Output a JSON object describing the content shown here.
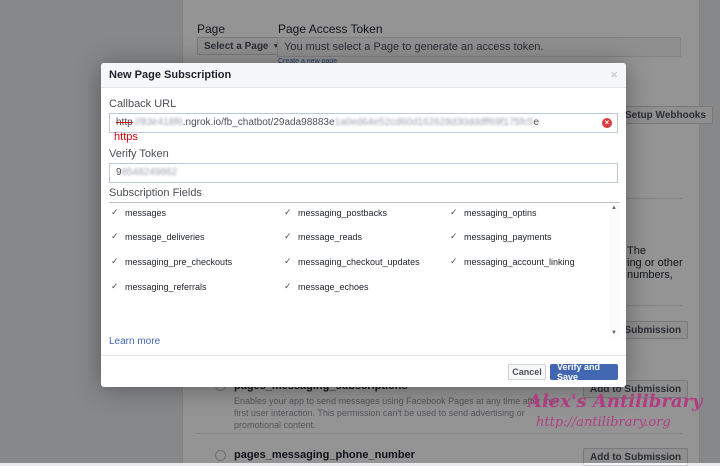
{
  "background": {
    "page_label": "Page",
    "select_page_button": "Select a Page",
    "access_token_label": "Page Access Token",
    "access_token_placeholder": "You must select a Page to generate an access token.",
    "create_page_link": "Create a new page",
    "setup_webhooks_button": "Setup Webhooks",
    "frag_the": "The",
    "frag_ing_or_other": "ing or other",
    "frag_numbers": "numbers,",
    "add_to_submission": "Add to Submission",
    "perm_subscription_title": "pages_messaging_subscriptions",
    "perm_subscription_desc": "Enables your app to send messages using Facebook Pages at any time after the first user interaction. This permission can't be used to send advertising or promotional content.",
    "perm_phone_title": "pages_messaging_phone_number"
  },
  "dialog": {
    "title": "New Page Subscription",
    "close_glyph": "×",
    "callback_label": "Callback URL",
    "callback_scheme": "http",
    "callback_blur1": "://83e418f6",
    "callback_visible": ".ngrok.io/fb_chatbot/29ada98883e",
    "callback_blur2": "1a0ed64e52cd60d162628d30dddff69f175fc5",
    "callback_end": "e",
    "https_note": "https",
    "verify_label": "Verify Token",
    "verify_prefix": "9",
    "verify_blur": "8548249862",
    "subscription_label": "Subscription Fields",
    "fields": [
      {
        "label": "messages",
        "checked": true
      },
      {
        "label": "messaging_postbacks",
        "checked": true
      },
      {
        "label": "messaging_optins",
        "checked": true
      },
      {
        "label": "message_deliveries",
        "checked": true
      },
      {
        "label": "message_reads",
        "checked": true
      },
      {
        "label": "messaging_payments",
        "checked": true
      },
      {
        "label": "messaging_pre_checkouts",
        "checked": true
      },
      {
        "label": "messaging_checkout_updates",
        "checked": true
      },
      {
        "label": "messaging_account_linking",
        "checked": true
      },
      {
        "label": "messaging_referrals",
        "checked": true
      },
      {
        "label": "message_echoes",
        "checked": true
      }
    ],
    "learn_more": "Learn more",
    "cancel": "Cancel",
    "verify_and_save": "Verify and Save"
  },
  "watermark": {
    "title": "Alex's Antilibrary",
    "url": "http://antilibrary.org"
  },
  "colors": {
    "accent": "#4267b2",
    "error": "#e0393e",
    "watermark": "#b13c83"
  }
}
